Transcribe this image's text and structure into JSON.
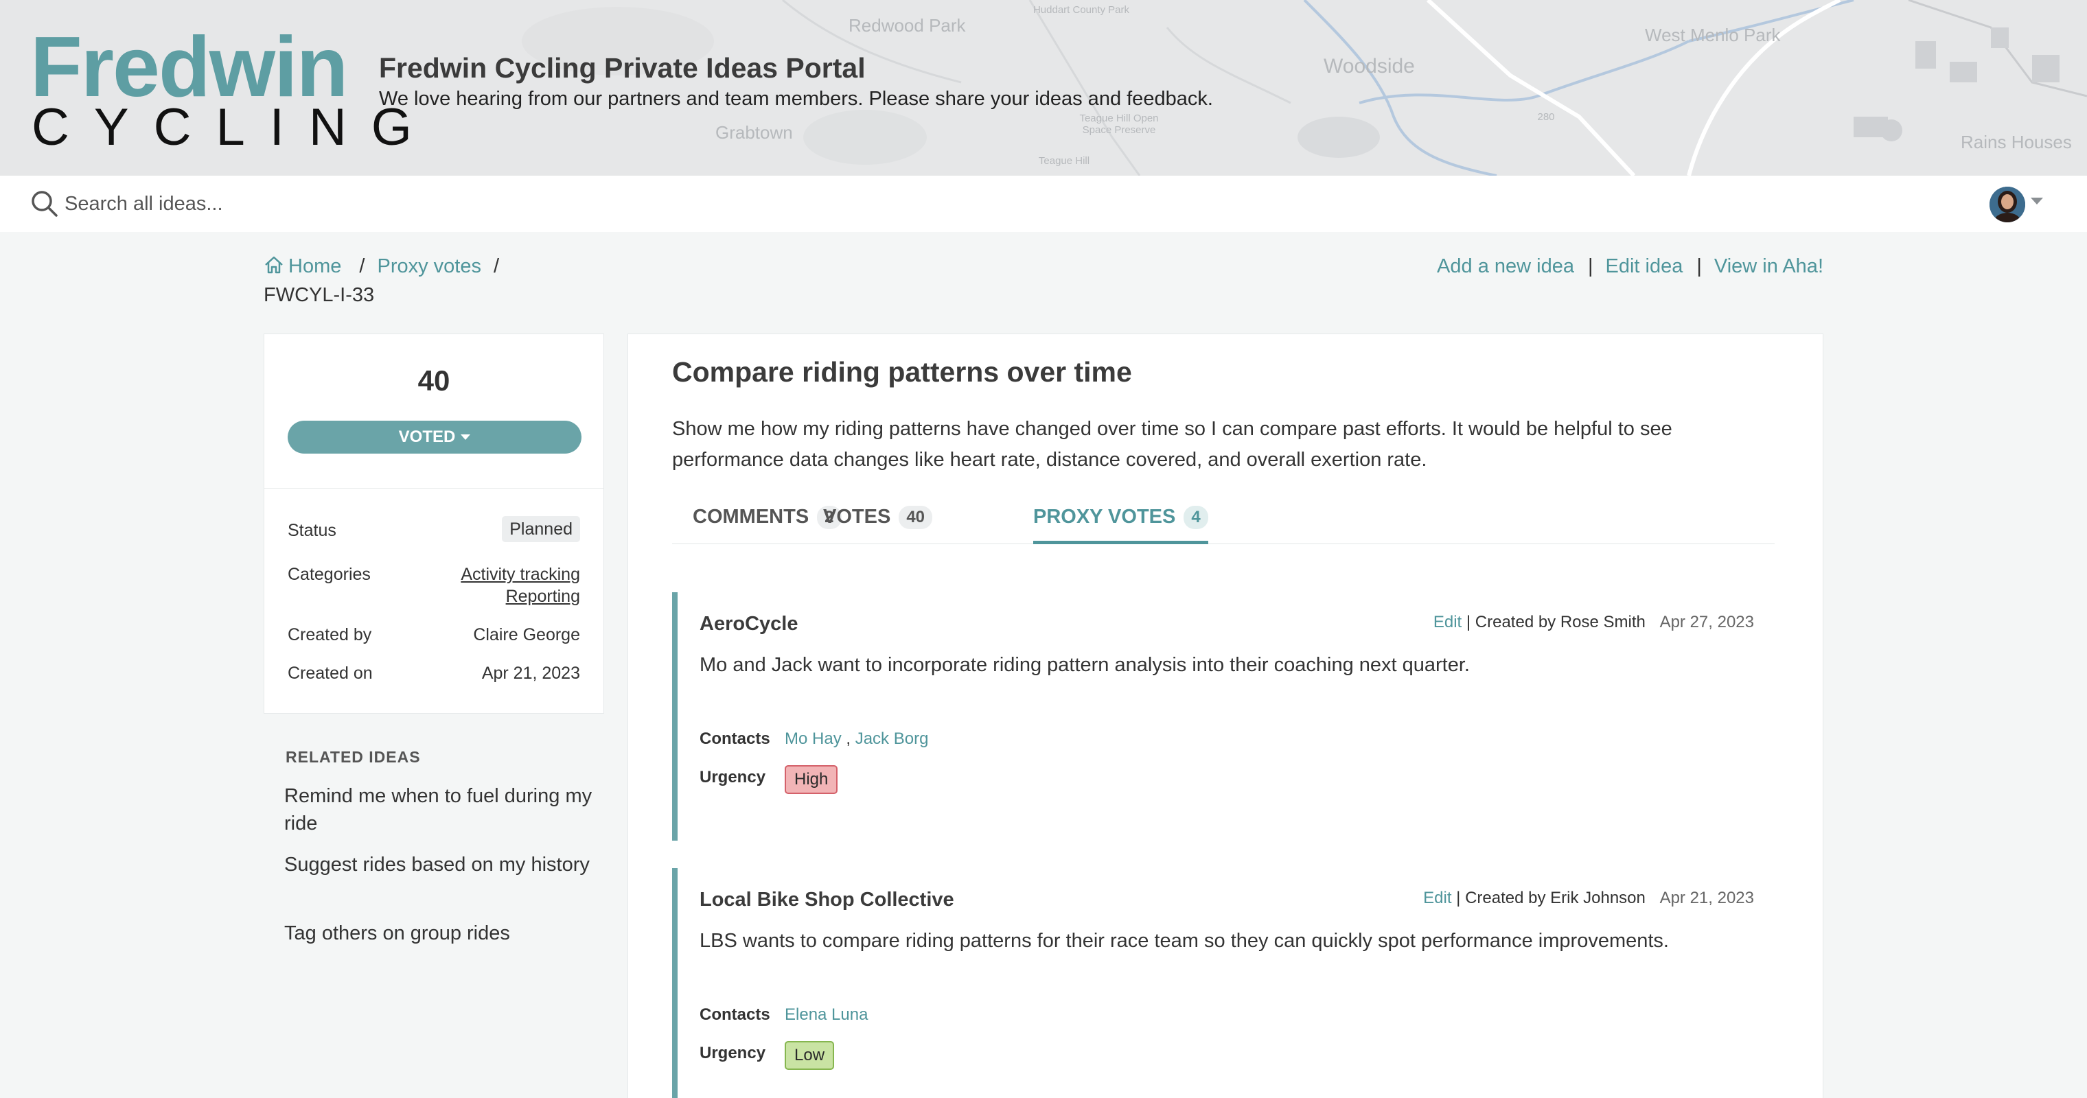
{
  "header": {
    "logo_word": "Fredwin",
    "logo_sub": "CYCLING",
    "portal_title": "Fredwin Cycling Private Ideas Portal",
    "portal_subtitle": "We love hearing from our partners and team members. Please share your ideas and feedback.",
    "map_labels": [
      "Redwood Park",
      "Huddart County Park",
      "Woodside",
      "West Menlo Park",
      "Grabtown",
      "Teague Hill Open Space Preserve",
      "Teague Hill",
      "Rains Houses",
      "280"
    ]
  },
  "search": {
    "placeholder": "Search all ideas..."
  },
  "breadcrumb": {
    "home": "Home",
    "section": "Proxy votes",
    "sep": "/",
    "current": "FWCYL-I-33"
  },
  "actions": {
    "add": "Add a new idea",
    "edit": "Edit idea",
    "view": "View in Aha!",
    "sep": "|"
  },
  "vote_card": {
    "count": "40",
    "voted_label": "VOTED",
    "properties": {
      "status_label": "Status",
      "status_value": "Planned",
      "categories_label": "Categories",
      "categories": [
        "Activity tracking",
        "Reporting"
      ],
      "created_by_label": "Created by",
      "created_by": "Claire George",
      "created_on_label": "Created on",
      "created_on": "Apr 21, 2023"
    }
  },
  "related": {
    "heading": "RELATED IDEAS",
    "items": [
      "Remind me when to fuel during my ride",
      "Suggest rides based on my history",
      "Tag others on group rides"
    ]
  },
  "idea": {
    "title": "Compare riding patterns over time",
    "description": "Show me how my riding patterns have changed over time so I can compare past efforts. It would be helpful to see performance data changes like heart rate, distance covered, and overall exertion rate."
  },
  "tabs": [
    {
      "label": "COMMENTS",
      "count": "2"
    },
    {
      "label": "VOTES",
      "count": "40"
    },
    {
      "label": "PROXY VOTES",
      "count": "4"
    }
  ],
  "proxy_votes": [
    {
      "org": "AeroCycle",
      "edit": "Edit",
      "created_by": "| Created by Rose Smith",
      "date": "Apr 27, 2023",
      "text": "Mo and Jack want to incorporate riding pattern analysis into their coaching next quarter.",
      "contacts_label": "Contacts",
      "contacts": [
        "Mo Hay",
        "Jack Borg"
      ],
      "contacts_sep": " , ",
      "urgency_label": "Urgency",
      "urgency": "High"
    },
    {
      "org": "Local Bike Shop Collective",
      "edit": "Edit",
      "created_by": "| Created by Erik Johnson",
      "date": "Apr 21, 2023",
      "text": "LBS wants to compare riding patterns for their race team so they can quickly spot performance improvements.",
      "contacts_label": "Contacts",
      "contacts": [
        "Elena Luna"
      ],
      "urgency_label": "Urgency",
      "urgency": "Low"
    }
  ],
  "colors": {
    "accent": "#4f959b",
    "button": "#6aa4a8",
    "urgency_high": "#f2b4b6",
    "urgency_low": "#c9e3a3"
  },
  "icons": {
    "search": "search-icon",
    "home": "home-icon",
    "avatar": "user-avatar",
    "caret": "caret-down-icon"
  }
}
